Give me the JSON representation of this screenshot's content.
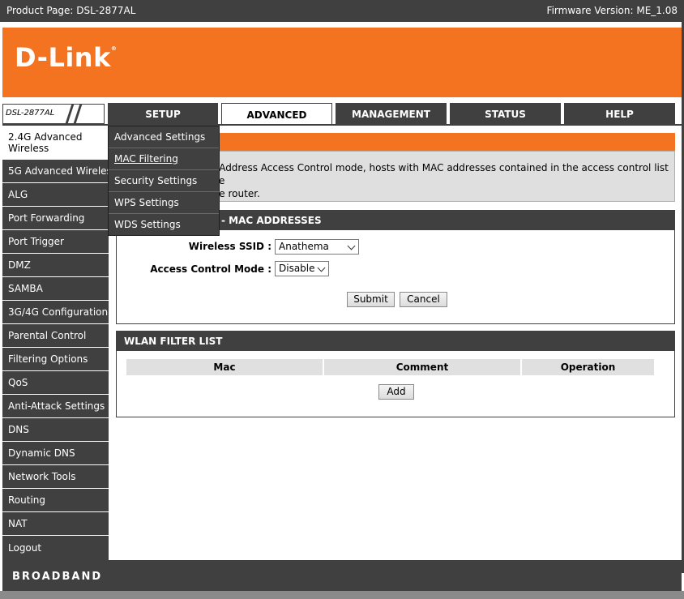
{
  "topbar": {
    "product": "Product Page: DSL-2877AL",
    "firmware": "Firmware Version: ME_1.08"
  },
  "logo": {
    "text": "D-Link",
    "mark": "®"
  },
  "model": "DSL-2877AL",
  "tabs": [
    {
      "label": "SETUP",
      "active": false
    },
    {
      "label": "ADVANCED",
      "active": true
    },
    {
      "label": "MANAGEMENT",
      "active": false
    },
    {
      "label": "STATUS",
      "active": false
    },
    {
      "label": "HELP",
      "active": false
    }
  ],
  "sidebar": {
    "active": "2.4G Advanced Wireless",
    "items": [
      "5G Advanced Wireless",
      "ALG",
      "Port Forwarding",
      "Port Trigger",
      "DMZ",
      "SAMBA",
      "3G/4G Configuration",
      "Parental Control",
      "Filtering Options",
      "QoS",
      "Anti-Attack Settings",
      "DNS",
      "Dynamic DNS",
      "Network Tools",
      "Routing",
      "NAT",
      "Logout"
    ]
  },
  "submenu": [
    "Advanced Settings",
    "MAC Filtering",
    "Security Settings",
    "WPS Settings",
    "WDS Settings"
  ],
  "info": {
    "line1": "C Address Access Control mode, hosts with MAC addresses contained in the access control list are",
    "line2": "the router."
  },
  "mac_panel": {
    "title": "- MAC ADDRESSES",
    "ssid_label": "Wireless SSID :",
    "ssid_value": "Anathema",
    "mode_label": "Access Control Mode :",
    "mode_value": "Disable",
    "submit": "Submit",
    "cancel": "Cancel"
  },
  "wlan_panel": {
    "title": "WLAN FILTER LIST",
    "columns": [
      "Mac",
      "Comment",
      "Operation"
    ],
    "add": "Add"
  },
  "footer": "BROADBAND",
  "colors": {
    "orange": "#f47321",
    "dark": "#404040"
  }
}
